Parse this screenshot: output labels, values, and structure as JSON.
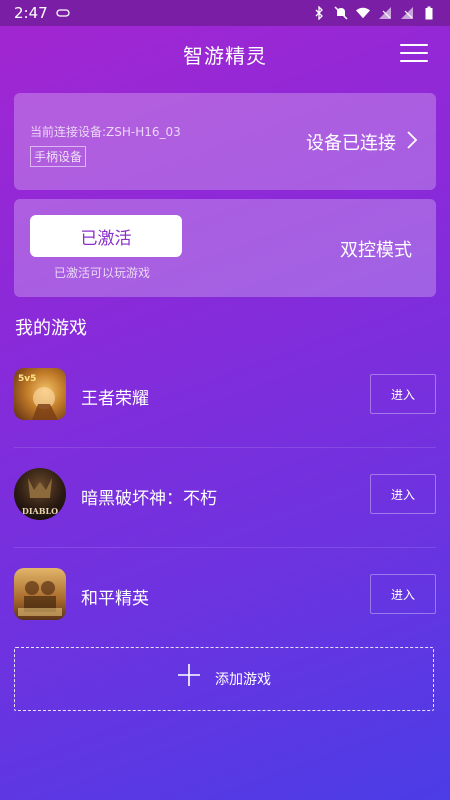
{
  "status_bar": {
    "time": "2:47",
    "icons": [
      "gamepad-icon",
      "bluetooth-icon",
      "mute-icon",
      "wifi-icon",
      "signal-off-icon",
      "signal-off-icon",
      "battery-icon"
    ]
  },
  "header": {
    "title": "智游精灵",
    "menu_icon": "hamburger-menu-icon"
  },
  "device_card": {
    "current_device": "当前连接设备:ZSH-H16_03",
    "device_type": "手柄设备",
    "status": "设备已连接"
  },
  "mode_card": {
    "activate_label": "已激活",
    "activate_note": "已激活可以玩游戏",
    "mode_label": "双控模式"
  },
  "my_games": {
    "title": "我的游戏",
    "games": [
      {
        "name": "王者荣耀",
        "enter_label": "进入",
        "icon_color": "#e0a033"
      },
      {
        "name": "暗黑破坏神：不朽",
        "enter_label": "进入",
        "icon_color": "#1a1410",
        "icon_text": "DIABLO"
      },
      {
        "name": "和平精英",
        "enter_label": "进入",
        "icon_color": "#c08a3a"
      }
    ]
  },
  "add_game": {
    "label": "添加游戏"
  }
}
